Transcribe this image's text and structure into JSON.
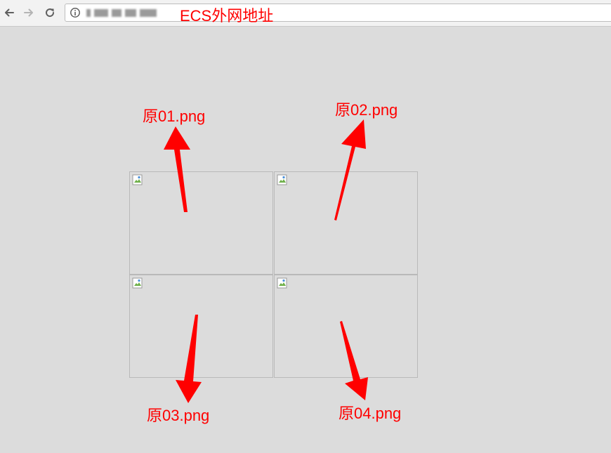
{
  "browser": {
    "back_icon": "arrow-left-icon",
    "forward_icon": "arrow-right-icon",
    "reload_icon": "reload-icon",
    "site_info_icon": "info-icon",
    "url": ""
  },
  "annotations": {
    "url_label": "ECS外网地址",
    "img1": "原01.png",
    "img2": "原02.png",
    "img3": "原03.png",
    "img4": "原04.png"
  },
  "images": [
    {
      "icon": "broken-image-icon"
    },
    {
      "icon": "broken-image-icon"
    },
    {
      "icon": "broken-image-icon"
    },
    {
      "icon": "broken-image-icon"
    }
  ],
  "colors": {
    "annotation": "#ff0000",
    "page_background": "#dcdcdc",
    "cell_border": "#b9b9b9"
  }
}
